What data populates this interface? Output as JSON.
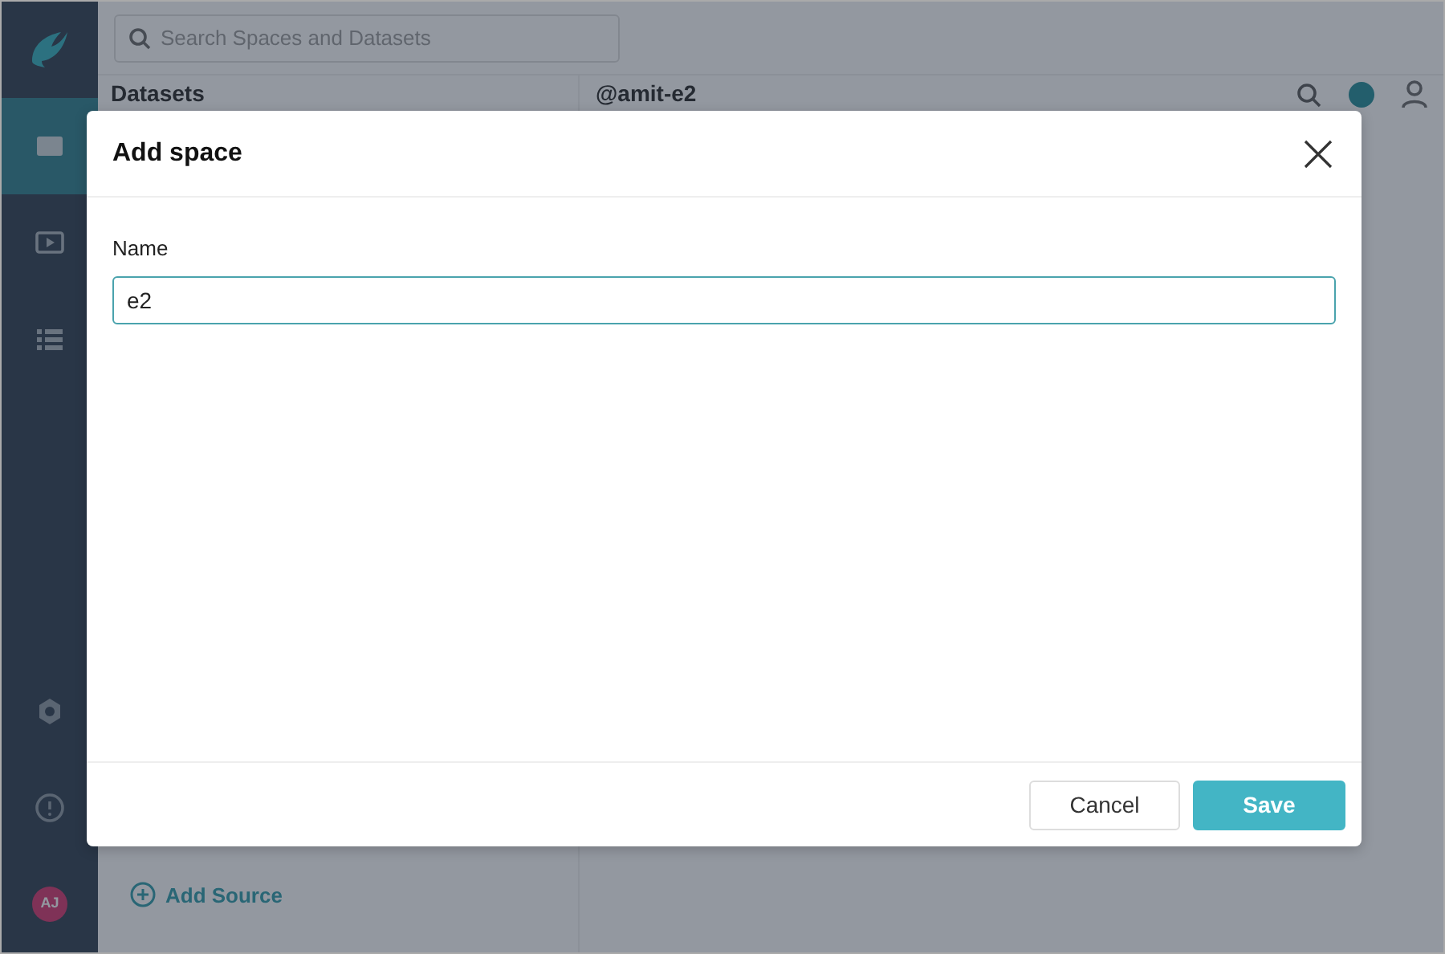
{
  "sidebar": {
    "items": [
      {
        "kind": "grid",
        "selected": true
      },
      {
        "kind": "play",
        "selected": false
      },
      {
        "kind": "list",
        "selected": false
      }
    ],
    "bottom": [
      {
        "kind": "gear"
      },
      {
        "kind": "help"
      }
    ],
    "avatar": "AJ"
  },
  "search": {
    "placeholder": "Search Spaces and Datasets"
  },
  "panel": {
    "title": "Datasets",
    "add_source": "Add Source"
  },
  "header": {
    "title": "@amit-e2"
  },
  "modal": {
    "title": "Add space",
    "field": {
      "label": "Name",
      "value": "e2"
    },
    "buttons": [
      {
        "label": "Cancel",
        "kind": "secondary"
      },
      {
        "label": "Save",
        "kind": "primary"
      }
    ]
  }
}
